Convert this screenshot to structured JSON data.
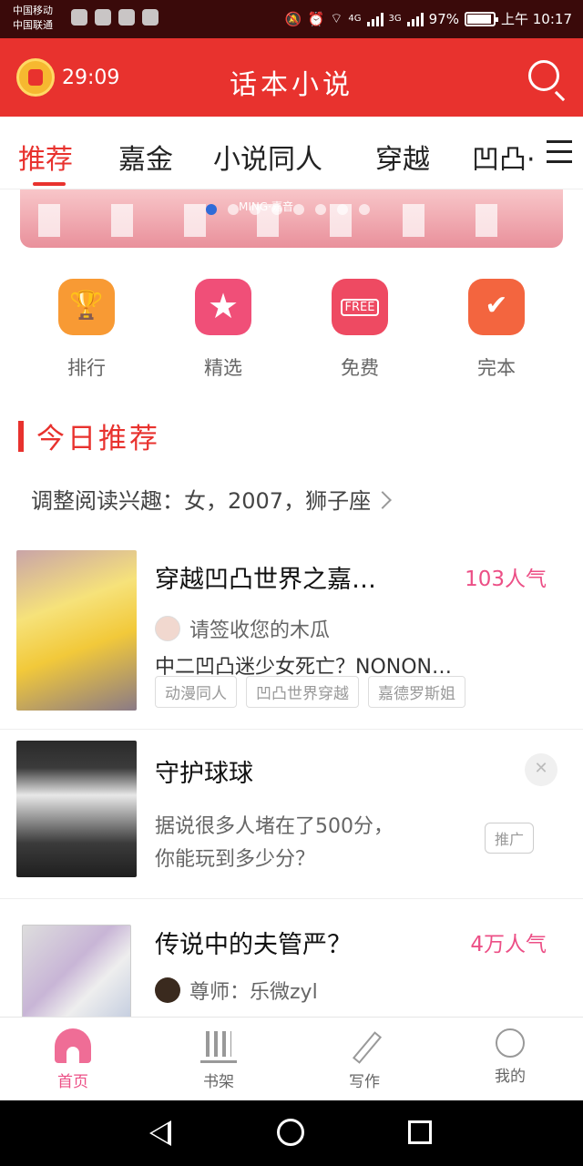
{
  "status_bar": {
    "carrier1": "中国移动",
    "carrier2": "中国联通",
    "network1": "4G",
    "network2": "3G",
    "battery": "97%",
    "time": "上午 10:17"
  },
  "header": {
    "timer": "29:09",
    "title": "话本小说"
  },
  "tabs": [
    "推荐",
    "嘉金",
    "小说同人",
    "穿越",
    "凹凸·"
  ],
  "active_tab": 0,
  "banner": {
    "text": "MING·嘉音",
    "slide_count": 8,
    "active_slide": 0
  },
  "categories": [
    {
      "label": "排行",
      "icon": "trophy-icon"
    },
    {
      "label": "精选",
      "icon": "star-icon"
    },
    {
      "label": "免费",
      "icon": "free-icon"
    },
    {
      "label": "完本",
      "icon": "check-icon"
    }
  ],
  "section": {
    "title": "今日推荐",
    "interest": "调整阅读兴趣：女，2007，狮子座"
  },
  "cards": [
    {
      "title": "穿越凹凸世界之嘉…",
      "heat": "103人气",
      "author": "请签收您的木瓜",
      "desc": "中二凹凸迷少女死亡？NONON…",
      "tags": [
        "动漫同人",
        "凹凸世界穿越",
        "嘉德罗斯姐"
      ]
    }
  ],
  "ad": {
    "title": "守护球球",
    "desc_line1": "据说很多人堵在了500分，",
    "desc_line2": "你能玩到多少分？",
    "badge": "推广"
  },
  "card2": {
    "title": "传说中的夫管严？",
    "heat": "4万人气",
    "author": "尊师：乐微zyl"
  },
  "bottom_nav": [
    {
      "label": "首页",
      "icon": "home-icon"
    },
    {
      "label": "书架",
      "icon": "bookshelf-icon"
    },
    {
      "label": "写作",
      "icon": "pen-icon"
    },
    {
      "label": "我的",
      "icon": "profile-icon"
    }
  ],
  "colors": {
    "brand_red": "#e8322e",
    "heat_pink": "#ec4f86"
  }
}
